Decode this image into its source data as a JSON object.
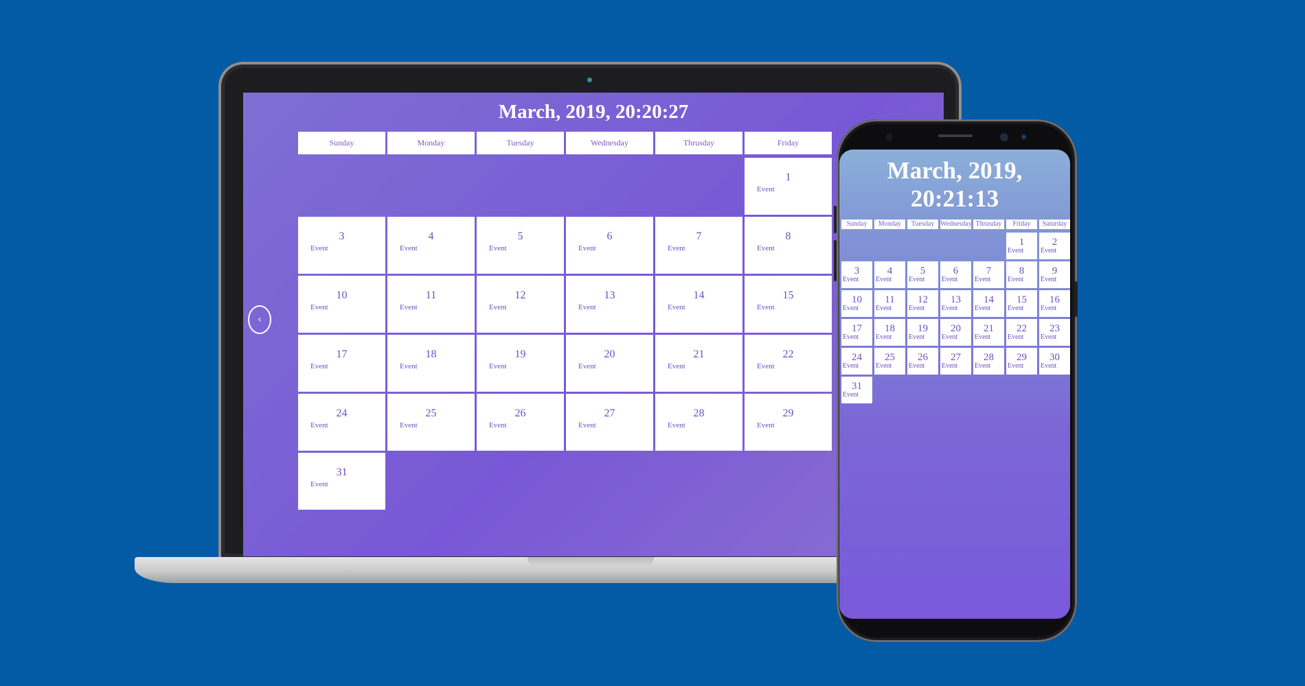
{
  "colors": {
    "background": "#035aa5",
    "accent": "#7858d6",
    "cell_text": "#6a4fc0"
  },
  "icons": {
    "prev": "chevron-left-icon"
  },
  "laptop": {
    "title": "March, 2019, 20:20:27",
    "prev_symbol": "‹",
    "weekdays": [
      "Sunday",
      "Monday",
      "Tuesday",
      "Wednesday",
      "Thrusday",
      "Friday"
    ]
  },
  "phone": {
    "title_line1": "March, 2019,",
    "title_line2": "20:21:13",
    "weekdays": [
      "Sunday",
      "Monday",
      "Tuesday",
      "Wednesday",
      "Thrusday",
      "Friday",
      "Saturday"
    ]
  },
  "event_label": "Event",
  "days": [
    {
      "day": "1",
      "event": "Event"
    },
    {
      "day": "2",
      "event": "Event"
    },
    {
      "day": "3",
      "event": "Event"
    },
    {
      "day": "4",
      "event": "Event"
    },
    {
      "day": "5",
      "event": "Event"
    },
    {
      "day": "6",
      "event": "Event"
    },
    {
      "day": "7",
      "event": "Event"
    },
    {
      "day": "8",
      "event": "Event"
    },
    {
      "day": "9",
      "event": "Event"
    },
    {
      "day": "10",
      "event": "Event"
    },
    {
      "day": "11",
      "event": "Event"
    },
    {
      "day": "12",
      "event": "Event"
    },
    {
      "day": "13",
      "event": "Event"
    },
    {
      "day": "14",
      "event": "Event"
    },
    {
      "day": "15",
      "event": "Event"
    },
    {
      "day": "16",
      "event": "Event"
    },
    {
      "day": "17",
      "event": "Event"
    },
    {
      "day": "18",
      "event": "Event"
    },
    {
      "day": "19",
      "event": "Event"
    },
    {
      "day": "20",
      "event": "Event"
    },
    {
      "day": "21",
      "event": "Event"
    },
    {
      "day": "22",
      "event": "Event"
    },
    {
      "day": "23",
      "event": "Event"
    },
    {
      "day": "24",
      "event": "Event"
    },
    {
      "day": "25",
      "event": "Event"
    },
    {
      "day": "26",
      "event": "Event"
    },
    {
      "day": "27",
      "event": "Event"
    },
    {
      "day": "28",
      "event": "Event"
    },
    {
      "day": "29",
      "event": "Event"
    },
    {
      "day": "30",
      "event": "Event"
    },
    {
      "day": "31",
      "event": "Event"
    }
  ],
  "first_weekday_index": 5
}
